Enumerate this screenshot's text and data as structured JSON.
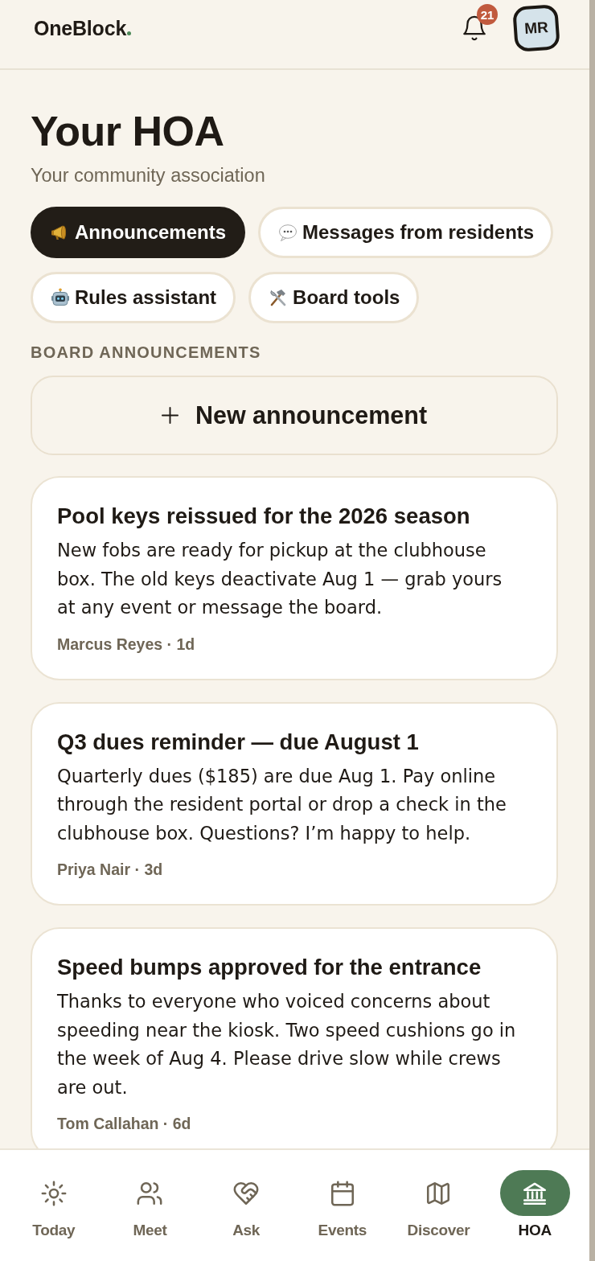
{
  "header": {
    "logo": "OneBlock",
    "notification_count": "21",
    "avatar_initials": "MR"
  },
  "page": {
    "title": "Your HOA",
    "subtitle": "Your community association"
  },
  "tabs": [
    {
      "label": "Announcements",
      "selected": true
    },
    {
      "label": "Messages from residents",
      "selected": false
    },
    {
      "label": "Rules assistant",
      "selected": false
    },
    {
      "label": "Board tools",
      "selected": false
    }
  ],
  "section_heading": "BOARD ANNOUNCEMENTS",
  "new_button": {
    "label": "New announcement"
  },
  "announcements": [
    {
      "title": "Pool keys reissued for the 2026 season",
      "body": "New fobs are ready for pickup at the clubhouse box. The old keys deactivate Aug 1 — grab yours at any event or message the board.",
      "meta": "Marcus Reyes · 1d"
    },
    {
      "title": "Q3 dues reminder — due August 1",
      "body": "Quarterly dues ($185) are due Aug 1. Pay online through the resident portal or drop a check in the clubhouse box. Questions? I’m happy to help.",
      "meta": "Priya Nair · 3d"
    },
    {
      "title": "Speed bumps approved for the entrance",
      "body": "Thanks to everyone who voiced concerns about speeding near the kiosk. Two speed cushions go in the week of Aug 4. Please drive slow while crews are out.",
      "meta": "Tom Callahan · 6d"
    }
  ],
  "nav": [
    {
      "label": "Today",
      "selected": false
    },
    {
      "label": "Meet",
      "selected": false
    },
    {
      "label": "Ask",
      "selected": false
    },
    {
      "label": "Events",
      "selected": false
    },
    {
      "label": "Discover",
      "selected": false
    },
    {
      "label": "HOA",
      "selected": true
    }
  ]
}
